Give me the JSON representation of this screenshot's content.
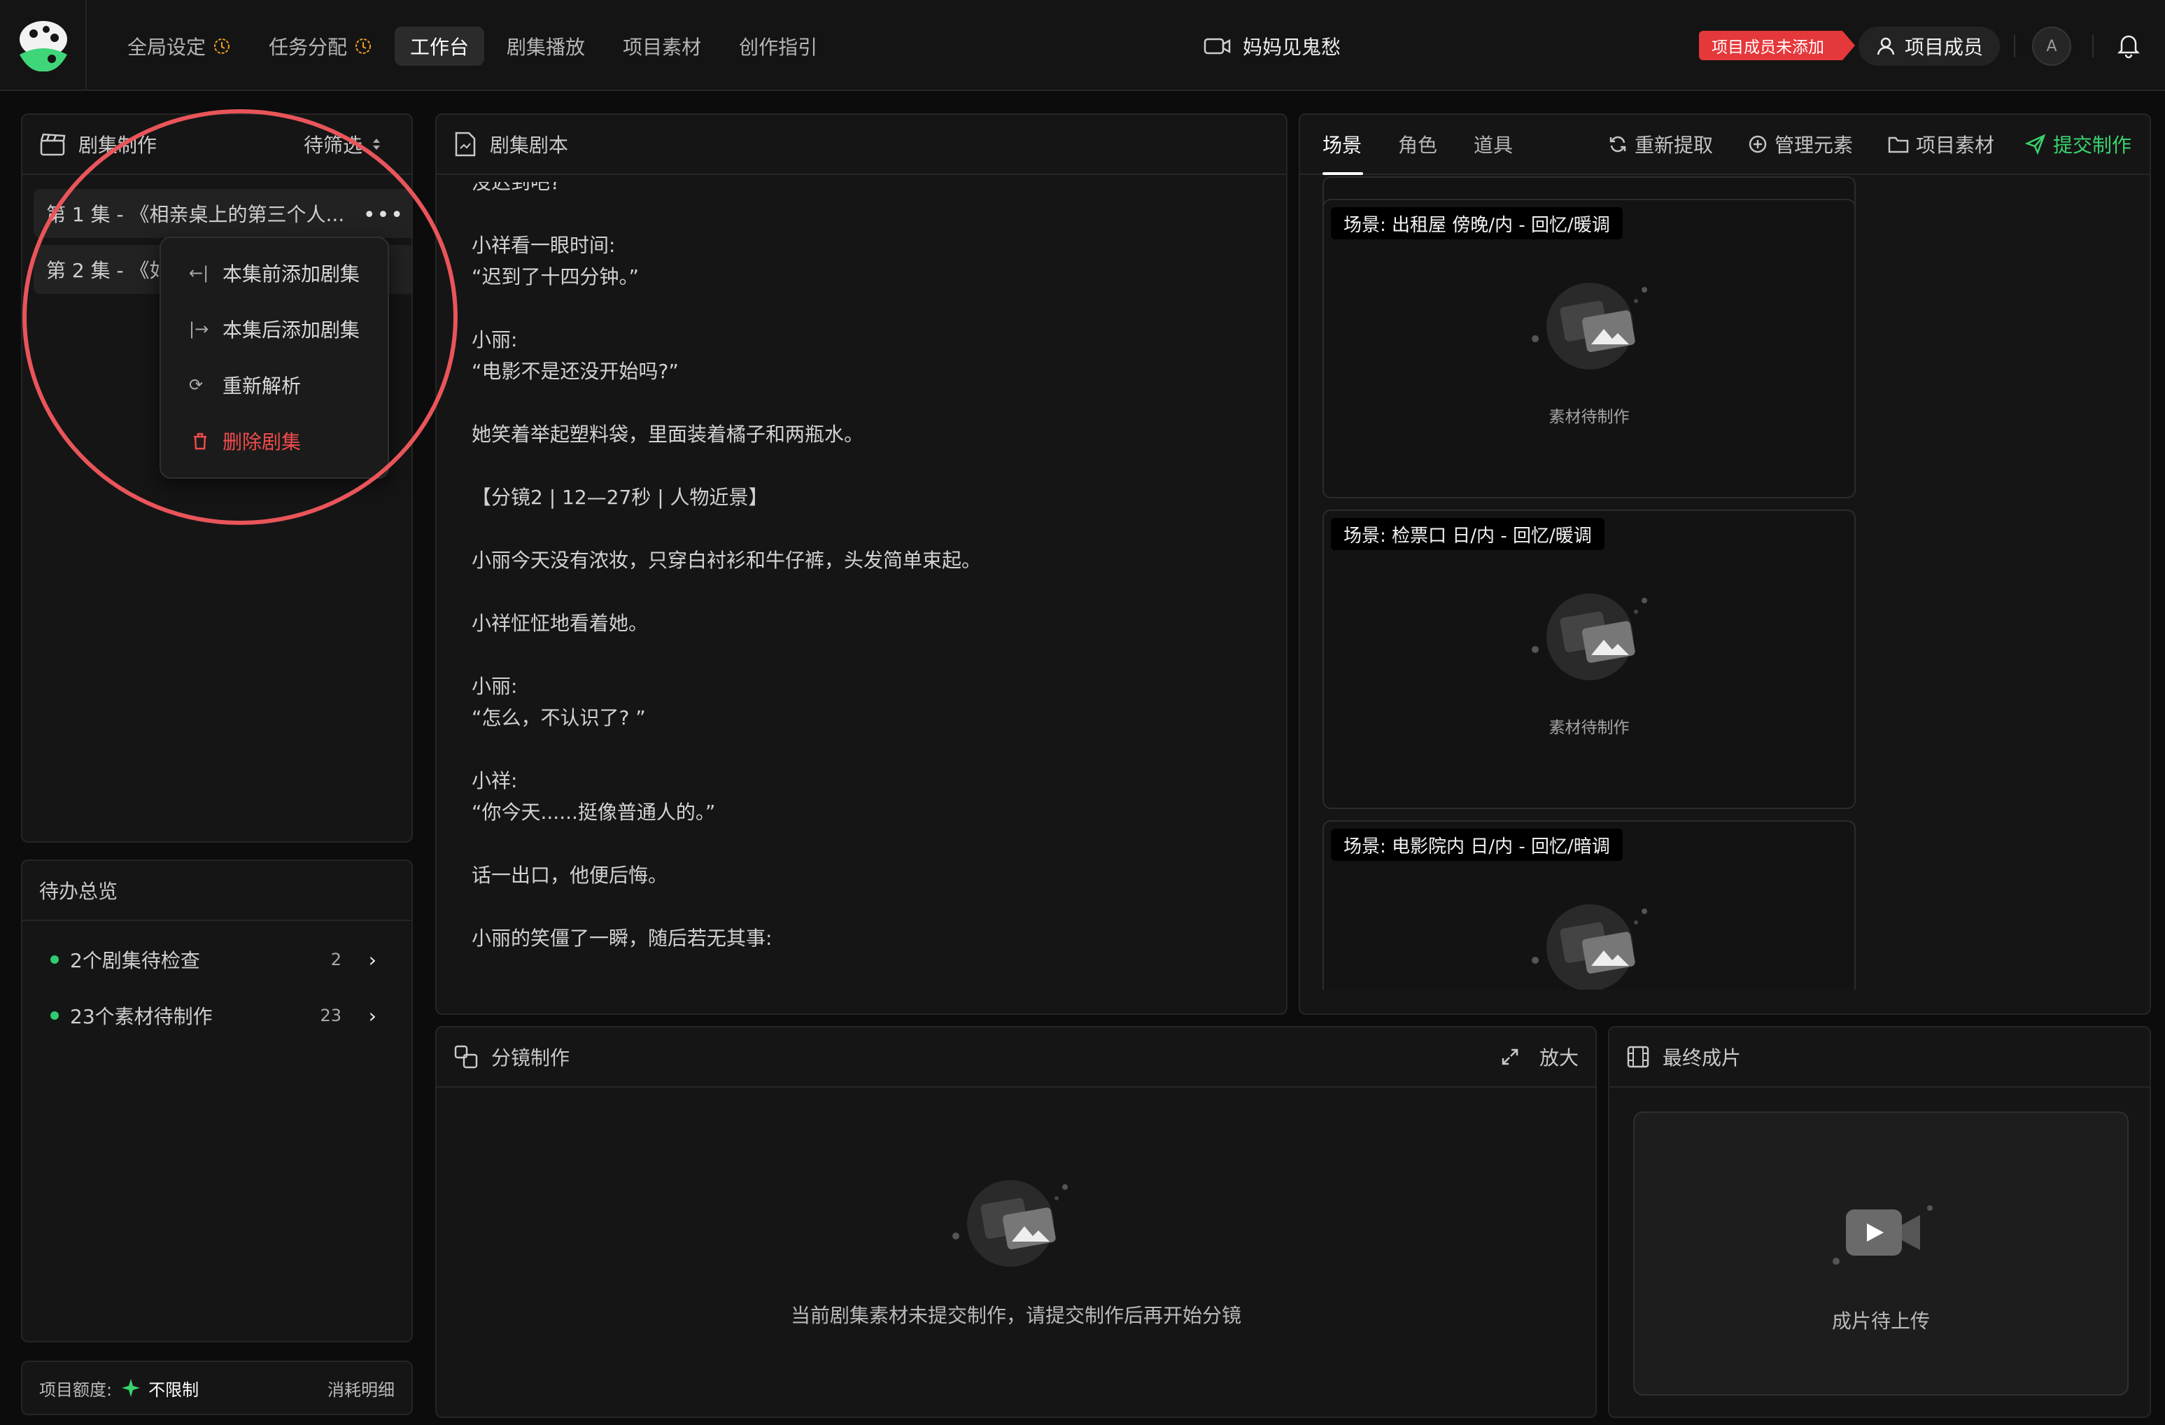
{
  "nav": {
    "items": [
      "全局设定",
      "任务分配",
      "工作台",
      "剧集播放",
      "项目素材",
      "创作指引"
    ],
    "active": "工作台"
  },
  "project": {
    "title": "妈妈见鬼愁"
  },
  "header": {
    "badge": "项目成员未添加",
    "members_label": "项目成员",
    "avatar_letter": "A"
  },
  "episodes": {
    "title": "剧集制作",
    "filter": "待筛选",
    "items": [
      "第 1 集 - 《相亲桌上的第三个人...",
      "第 2 集 - 《如"
    ],
    "menu": [
      "本集前添加剧集",
      "本集后添加剧集",
      "重新解析",
      "删除剧集"
    ]
  },
  "todo": {
    "title": "待办总览",
    "items": [
      {
        "label": "2个剧集待检查",
        "count": "2"
      },
      {
        "label": "23个素材待制作",
        "count": "23"
      }
    ]
  },
  "quota": {
    "label": "项目额度:",
    "value": "不限制",
    "detail": "消耗明细"
  },
  "script": {
    "title": "剧集剧本",
    "lines": [
      "没迟到吧?",
      "",
      "小祥看一眼时间:",
      "“迟到了十四分钟。”",
      "",
      "小丽:",
      "“电影不是还没开始吗?”",
      "",
      "她笑着举起塑料袋，里面装着橘子和两瓶水。",
      "",
      "【分镜2 | 12—27秒 | 人物近景】",
      "",
      "小丽今天没有浓妆，只穿白衬衫和牛仔裤，头发简单束起。",
      "",
      "小祥怔怔地看着她。",
      "",
      "小丽:",
      "“怎么，不认识了? ”",
      "",
      "小祥:",
      "“你今天......挺像普通人的。”",
      "",
      "话一出口，他便后悔。",
      "",
      "小丽的笑僵了一瞬，随后若无其事:"
    ]
  },
  "assets": {
    "tabs": [
      "场景",
      "角色",
      "道具"
    ],
    "active_tab": "场景",
    "actions": [
      "重新提取",
      "管理元素",
      "项目素材",
      "提交制作"
    ],
    "scenes": [
      {
        "label": "场景:  出租屋 傍晚/内 - 回忆/暖调",
        "status": "素材待制作"
      },
      {
        "label": "场景:  检票口 日/内 - 回忆/暖调",
        "status": "素材待制作"
      },
      {
        "label": "场景:  电影院内 日/内 - 回忆/暗调",
        "status": ""
      }
    ]
  },
  "storyboard": {
    "title": "分镜制作",
    "zoom": "放大",
    "empty": "当前剧集素材未提交制作，请提交制作后再开始分镜"
  },
  "final": {
    "title": "最终成片",
    "empty": "成片待上传"
  },
  "colors": {
    "accent_green": "#39d36e",
    "danger": "#e5383b",
    "bg": "#0c0c0c"
  }
}
